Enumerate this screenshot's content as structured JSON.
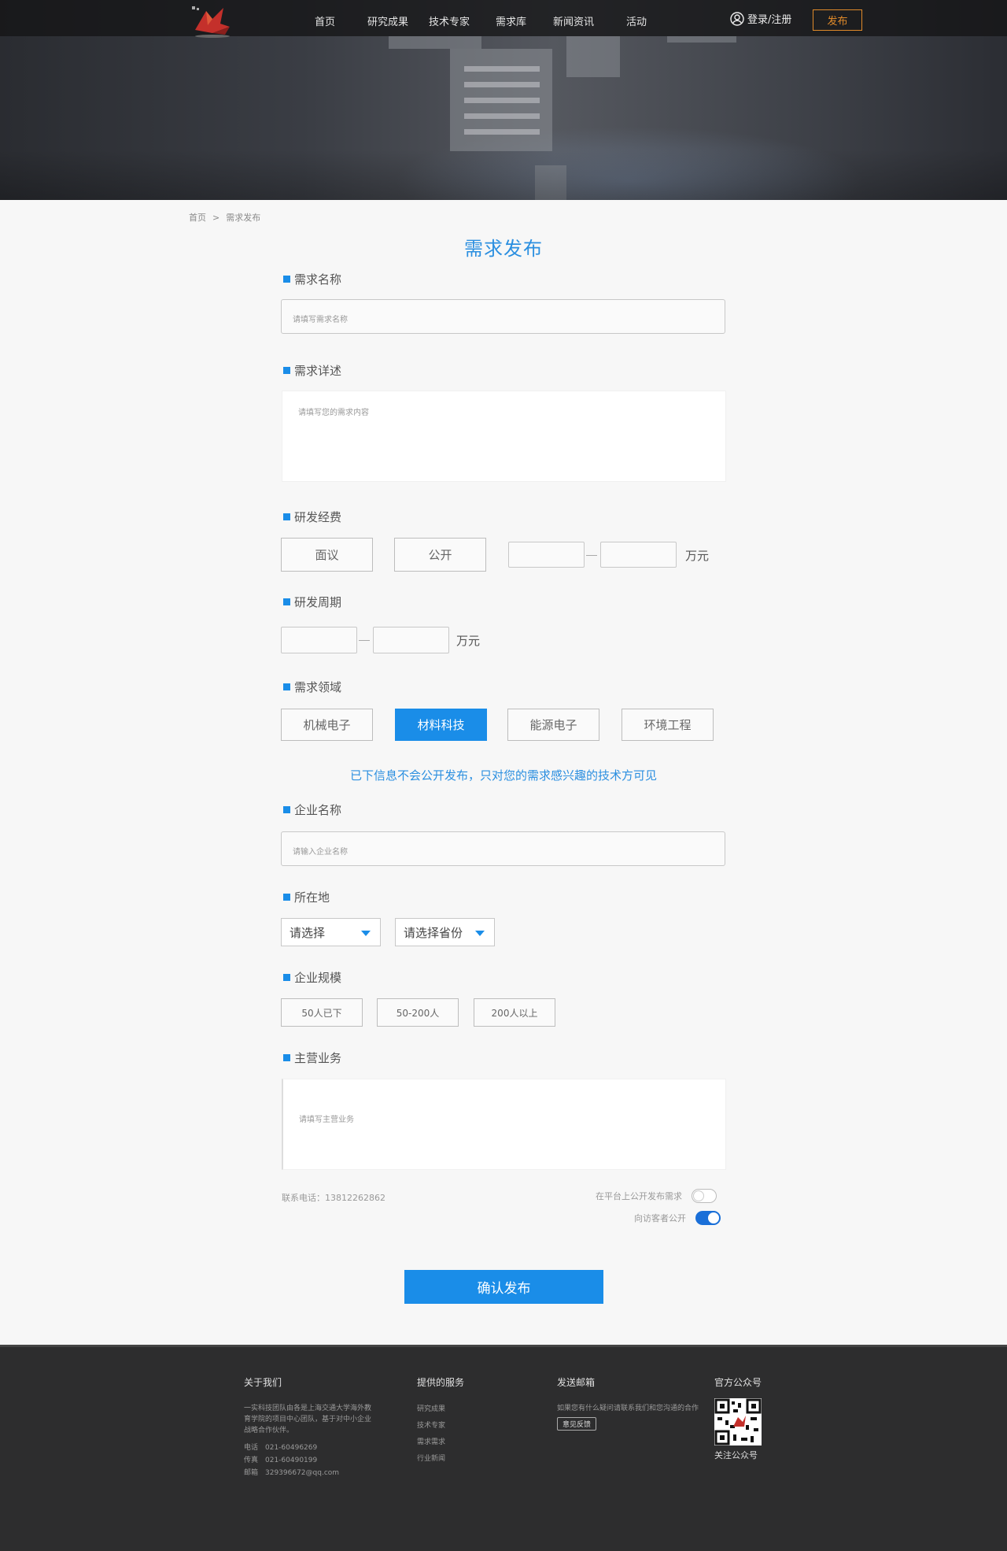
{
  "header": {
    "nav": [
      "首页",
      "研究成果",
      "技术专家",
      "需求库",
      "新闻资讯",
      "活动"
    ],
    "login_label": "登录/注册",
    "publish_label": "发布"
  },
  "breadcrumb": {
    "home": "首页",
    "sep": ">",
    "current": "需求发布"
  },
  "page_title": "需求发布",
  "form": {
    "name": {
      "label": "需求名称",
      "placeholder": "请填写需求名称"
    },
    "detail": {
      "label": "需求详述",
      "placeholder": "请填写您的需求内容"
    },
    "budget": {
      "label": "研发经费",
      "options": [
        "面议",
        "公开"
      ],
      "unit": "万元"
    },
    "cycle": {
      "label": "研发周期",
      "unit": "万元"
    },
    "domain": {
      "label": "需求领域",
      "options": [
        "机械电子",
        "材料科技",
        "能源电子",
        "环境工程"
      ],
      "selected": "材料科技"
    },
    "notice": "已下信息不会公开发布，只对您的需求感兴趣的技术方可见",
    "company": {
      "label": "企业名称",
      "placeholder": "请输入企业名称"
    },
    "location": {
      "label": "所在地",
      "select1": "请选择",
      "select2": "请选择省份"
    },
    "scale": {
      "label": "企业规模",
      "options": [
        "50人已下",
        "50-200人",
        "200人以上"
      ]
    },
    "business": {
      "label": "主营业务",
      "placeholder": "请填写主营业务"
    },
    "contact": "联系电话：13812262862",
    "public_switch": {
      "label": "在平台上公开发布需求",
      "on": false
    },
    "visitor_switch": {
      "label": "向访客者公开",
      "on": true
    },
    "confirm": "确认发布"
  },
  "footer": {
    "about": {
      "title": "关于我们",
      "text": "一实科技团队由各是上海交通大学海外教育学院的项目中心团队，基于对中小企业战略合作伙伴。",
      "phone": "电话　021-60496269",
      "fax": "传真　021-60490199",
      "email": "邮箱　329396672@qq.com"
    },
    "services": {
      "title": "提供的服务",
      "items": [
        "研究成果",
        "技术专家",
        "需求需求",
        "行业新闻"
      ]
    },
    "mail": {
      "title": "发送邮箱",
      "text": "如果您有什么疑问请联系我们和您沟通的合作",
      "button": "意见反馈"
    },
    "official": {
      "title": "官方公众号",
      "caption": "关注公众号"
    }
  },
  "colors": {
    "accent": "#1a8de8",
    "publish": "#e08a2a",
    "footer_bg": "#2d2d2e"
  }
}
